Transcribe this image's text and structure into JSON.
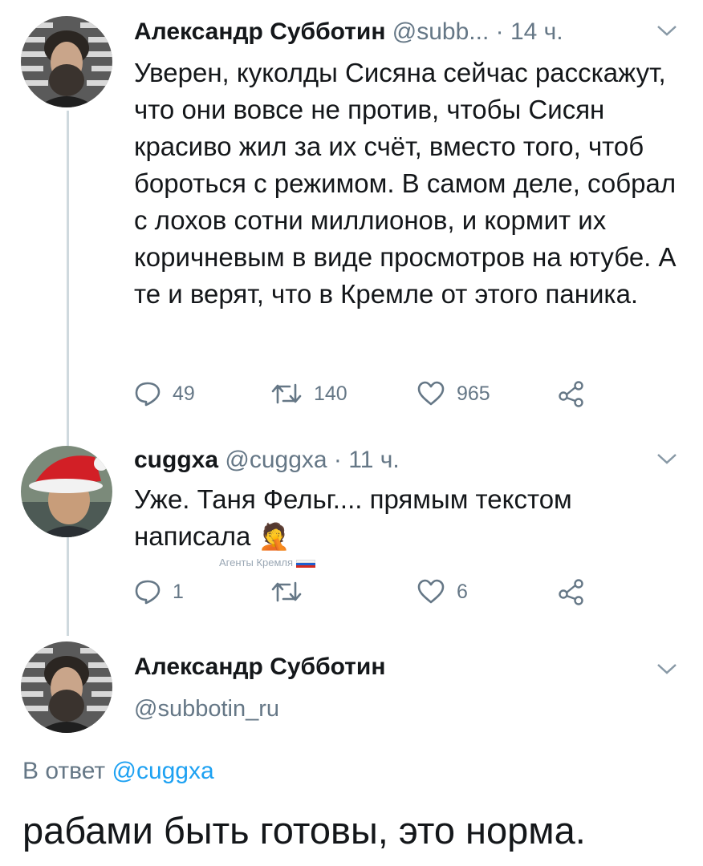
{
  "colors": {
    "accent": "#1da1f2",
    "secondary_text": "#657786",
    "thread_line": "#cfd9de"
  },
  "tweet1": {
    "author_name": "Александр Субботин",
    "author_handle": "@subb...",
    "time": "· 14 ч.",
    "text": "Уверен, куколды Сисяна сейчас расскажут, что они вовсе не против, чтобы Сисян красиво жил за их счёт, вместо того, чтоб бороться с режимом. В самом деле, собрал с лохов сотни миллионов, и кормит их коричневым в виде просмотров на ютубе. А те и верят, что в Кремле от этого паника.",
    "replies": "49",
    "retweets": "140",
    "likes": "965",
    "icons": [
      "reply-icon",
      "retweet-icon",
      "like-icon",
      "share-icon",
      "chevron-down-icon"
    ]
  },
  "tweet2": {
    "author_name": "cuggxa",
    "author_handle": "@cuggxa",
    "time": "· 11 ч.",
    "text": "Уже. Таня Фельг.... прямым текстом написала",
    "emoji": "🤦",
    "replies": "1",
    "likes": "6",
    "watermark": "Агенты Кремля",
    "icons": [
      "reply-icon",
      "retweet-icon",
      "like-icon",
      "share-icon",
      "chevron-down-icon"
    ]
  },
  "main": {
    "author_name": "Александр Субботин",
    "author_handle": "@subbotin_ru",
    "reply_prefix": "В ответ",
    "reply_mention": "@cuggxa",
    "text": "рабами быть готовы, это норма."
  }
}
